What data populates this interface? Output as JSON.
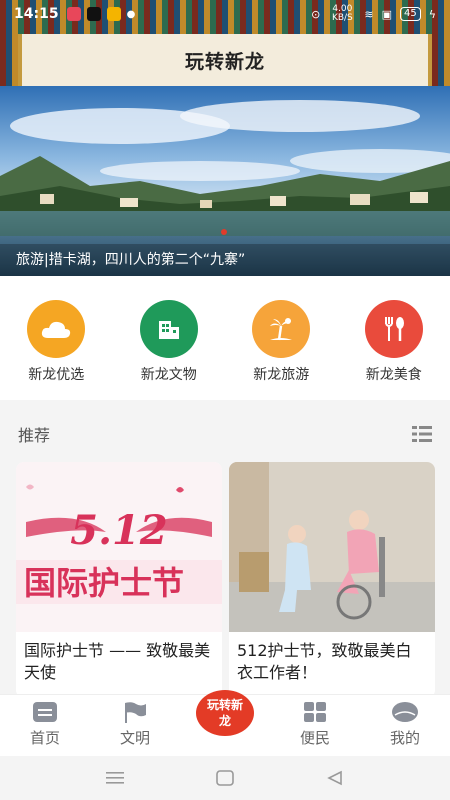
{
  "status_bar": {
    "time": "14:15",
    "network_speed": "4.00 KB/S",
    "battery": "45"
  },
  "header": {
    "title": "玩转新龙"
  },
  "banner": {
    "caption": "旅游|措卡湖，四川人的第二个“九寨”"
  },
  "quick_nav": [
    {
      "label": "新龙优选",
      "icon": "cloud-icon",
      "color": "#f5a623"
    },
    {
      "label": "新龙文物",
      "icon": "building-icon",
      "color": "#1f9a5a"
    },
    {
      "label": "新龙旅游",
      "icon": "palm-tree-icon",
      "color": "#f6a43a"
    },
    {
      "label": "新龙美食",
      "icon": "fork-spoon-icon",
      "color": "#e94b3c"
    }
  ],
  "recommend": {
    "title": "推荐",
    "cards": [
      {
        "title": "国际护士节 —— 致敬最美天使",
        "image_text": "5.12\n国际护士节"
      },
      {
        "title": "512护士节，致敬最美白衣工作者！"
      }
    ]
  },
  "tabbar": {
    "items": [
      {
        "label": "首页"
      },
      {
        "label": "文明"
      },
      {
        "label": "玩转新龙"
      },
      {
        "label": "便民"
      },
      {
        "label": "我的"
      }
    ]
  },
  "colors": {
    "accent": "#e33b26"
  }
}
